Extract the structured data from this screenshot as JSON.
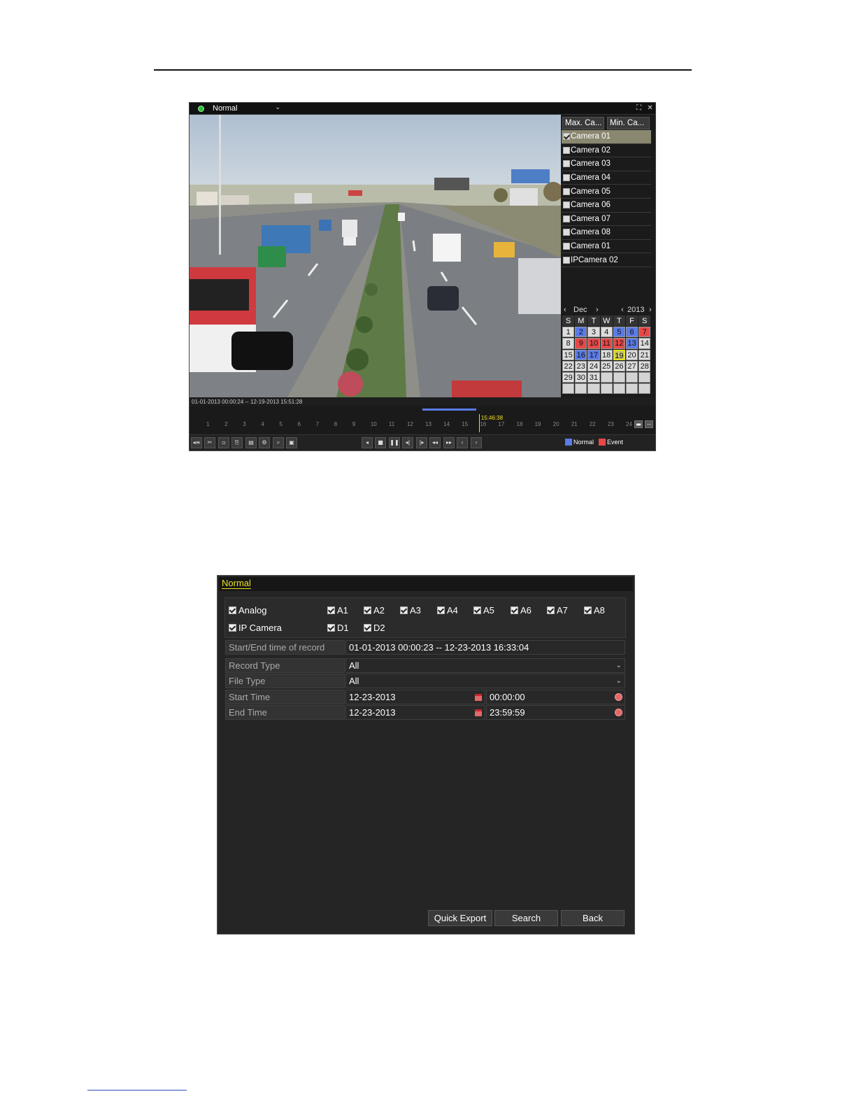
{
  "playback": {
    "mode_label": "Normal",
    "camera_buttons": [
      "Max. Ca...",
      "Min. Ca..."
    ],
    "cameras": [
      {
        "label": "Camera 01",
        "checked": true
      },
      {
        "label": "Camera 02",
        "checked": false
      },
      {
        "label": "Camera 03",
        "checked": false
      },
      {
        "label": "Camera 04",
        "checked": false
      },
      {
        "label": "Camera 05",
        "checked": false
      },
      {
        "label": "Camera 06",
        "checked": false
      },
      {
        "label": "Camera 07",
        "checked": false
      },
      {
        "label": "Camera 08",
        "checked": false
      },
      {
        "label": "Camera 01",
        "checked": false
      },
      {
        "label": "IPCamera 02",
        "checked": false
      }
    ],
    "calendar": {
      "month": "Dec",
      "year": "2013",
      "weekdays": [
        "S",
        "M",
        "T",
        "W",
        "T",
        "F",
        "S"
      ],
      "normal_days": [
        2,
        5,
        6,
        13,
        16,
        17
      ],
      "event_days": [
        7,
        9,
        10,
        11,
        12
      ],
      "today": 19,
      "days_in_month": 31,
      "first_weekday": 0
    },
    "record_range": "01-01-2013 00:00:24 -- 12-19-2013 15:51:28",
    "cursor_time": "15:46:38",
    "timeline_hours": [
      "1",
      "2",
      "3",
      "4",
      "5",
      "6",
      "7",
      "8",
      "9",
      "10",
      "11",
      "12",
      "13",
      "14",
      "15",
      "16",
      "17",
      "18",
      "19",
      "20",
      "21",
      "22",
      "23",
      "24"
    ],
    "timeline_position_fraction": 0.656,
    "normal_bar_start_fraction": 0.528,
    "normal_bar_end_fraction": 0.65,
    "legend": {
      "normal": "Normal",
      "event": "Event"
    },
    "colors": {
      "normal": "#5a7be8",
      "event": "#e84848",
      "cursor": "#f0e020"
    },
    "icons": {
      "toolbar_left": [
        "audio-icon",
        "clip-icon",
        "blank-icon",
        "lock-icon",
        "tag-icon",
        "settings-icon",
        "zoom-icon",
        "picture-icon"
      ],
      "toolbar_center": [
        "reverse-play-icon",
        "stop-icon",
        "pause-icon",
        "step-back-icon",
        "step-forward-icon",
        "rewind-icon",
        "fast-forward-icon",
        "previous-icon",
        "next-icon"
      ]
    }
  },
  "search": {
    "title": "Normal",
    "analog": {
      "label": "Analog",
      "channels": [
        "A1",
        "A2",
        "A3",
        "A4",
        "A5",
        "A6",
        "A7",
        "A8"
      ]
    },
    "ip": {
      "label": "IP Camera",
      "channels": [
        "D1",
        "D2"
      ]
    },
    "rows": {
      "record_time_label": "Start/End time of record",
      "record_time_value": "01-01-2013 00:00:23 -- 12-23-2013 16:33:04",
      "record_type_label": "Record Type",
      "record_type_value": "All",
      "file_type_label": "File Type",
      "file_type_value": "All",
      "start_label": "Start Time",
      "start_date": "12-23-2013",
      "start_time": "00:00:00",
      "end_label": "End Time",
      "end_date": "12-23-2013",
      "end_time": "23:59:59"
    },
    "buttons": {
      "quick_export": "Quick Export",
      "search": "Search",
      "back": "Back"
    }
  }
}
